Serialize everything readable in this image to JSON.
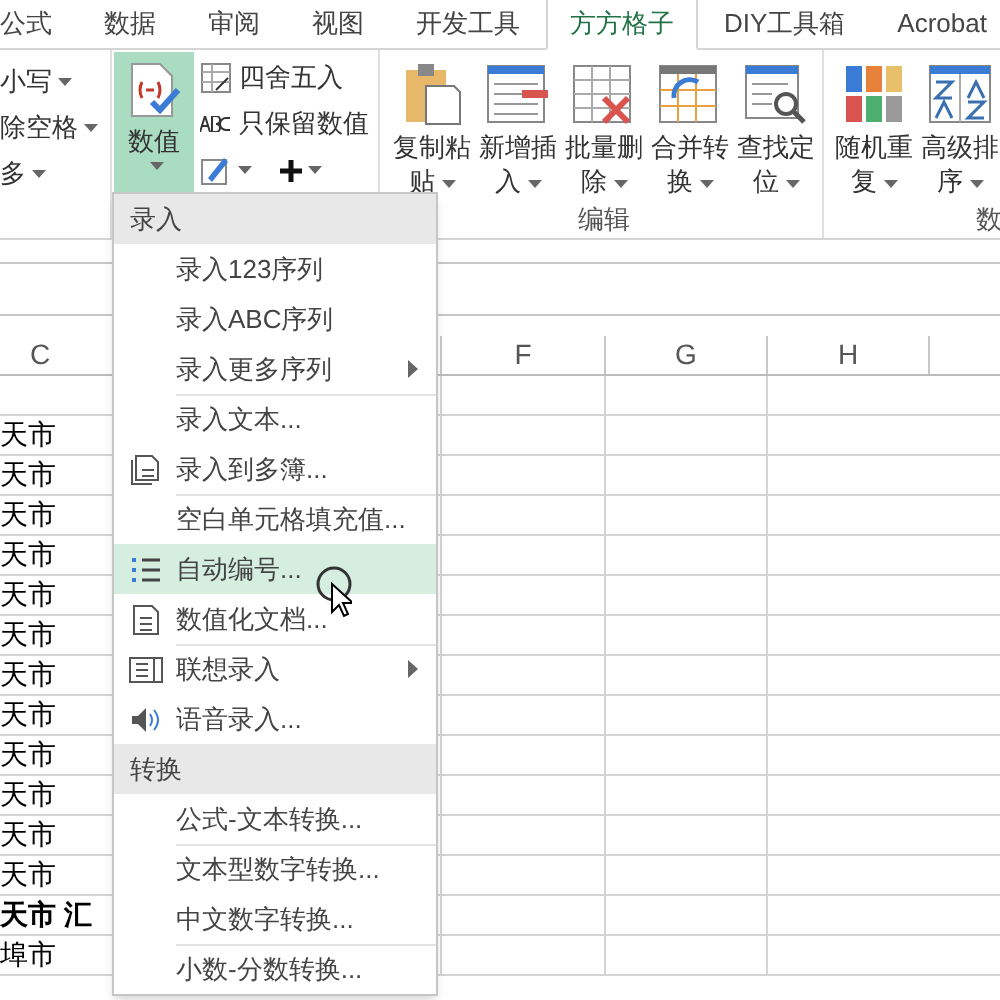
{
  "tabs": [
    {
      "label": "公式",
      "selected": false
    },
    {
      "label": "数据",
      "selected": false
    },
    {
      "label": "审阅",
      "selected": false
    },
    {
      "label": "视图",
      "selected": false
    },
    {
      "label": "开发工具",
      "selected": false
    },
    {
      "label": "方方格子",
      "selected": true
    },
    {
      "label": "DIY工具箱",
      "selected": false
    },
    {
      "label": "Acrobat",
      "selected": false
    }
  ],
  "ribbon": {
    "left_items": [
      "小写",
      "除空格",
      "多"
    ],
    "value_button": {
      "label": "数值",
      "selected": true
    },
    "small_buttons": [
      "四舍五入",
      "只保留数值"
    ],
    "edit_buttons": [
      "复制粘贴",
      "新增插入",
      "批量删除",
      "合并转换",
      "查找定位"
    ],
    "edit_group": "编辑",
    "data_buttons": [
      "随机重复",
      "高级排序"
    ],
    "data_group": "数"
  },
  "sheet": {
    "columns": [
      "C",
      "F",
      "G",
      "H"
    ],
    "rows": [
      {
        "c": "天市",
        "bold": false
      },
      {
        "c": "天市",
        "bold": false
      },
      {
        "c": "天市",
        "bold": false
      },
      {
        "c": "天市",
        "bold": false
      },
      {
        "c": "天市",
        "bold": false
      },
      {
        "c": "天市",
        "bold": false
      },
      {
        "c": "天市",
        "bold": false
      },
      {
        "c": "天市",
        "bold": false
      },
      {
        "c": "天市",
        "bold": false
      },
      {
        "c": "天市",
        "bold": false
      },
      {
        "c": "天市",
        "bold": false
      },
      {
        "c": "天市",
        "bold": false
      },
      {
        "c": "天市 汇",
        "bold": true
      },
      {
        "c": "埠市",
        "bold": false
      }
    ]
  },
  "menu": [
    {
      "kind": "header",
      "label": "录入"
    },
    {
      "kind": "item",
      "label": "录入123序列",
      "divider": false,
      "submenu": false,
      "selected": false
    },
    {
      "kind": "item",
      "label": "录入ABC序列",
      "divider": false,
      "submenu": false,
      "selected": false
    },
    {
      "kind": "item",
      "label": "录入更多序列",
      "divider": false,
      "submenu": true,
      "selected": false
    },
    {
      "kind": "item",
      "label": "录入文本...",
      "divider": true,
      "submenu": false,
      "selected": false
    },
    {
      "kind": "item",
      "label": "录入到多簿...",
      "divider": false,
      "submenu": false,
      "selected": false
    },
    {
      "kind": "item",
      "label": "空白单元格填充值...",
      "divider": true,
      "submenu": false,
      "selected": false
    },
    {
      "kind": "item",
      "label": "自动编号...",
      "divider": false,
      "submenu": false,
      "selected": true
    },
    {
      "kind": "item",
      "label": "数值化文档...",
      "divider": false,
      "submenu": false,
      "selected": false
    },
    {
      "kind": "item",
      "label": "联想录入",
      "divider": true,
      "submenu": true,
      "selected": false
    },
    {
      "kind": "item",
      "label": "语音录入...",
      "divider": false,
      "submenu": false,
      "selected": false
    },
    {
      "kind": "header",
      "label": "转换"
    },
    {
      "kind": "item",
      "label": "公式-文本转换...",
      "divider": false,
      "submenu": false,
      "selected": false
    },
    {
      "kind": "item",
      "label": "文本型数字转换...",
      "divider": true,
      "submenu": false,
      "selected": false
    },
    {
      "kind": "item",
      "label": "中文数字转换...",
      "divider": false,
      "submenu": false,
      "selected": false
    },
    {
      "kind": "item",
      "label": "小数-分数转换...",
      "divider": true,
      "submenu": false,
      "selected": false
    }
  ]
}
